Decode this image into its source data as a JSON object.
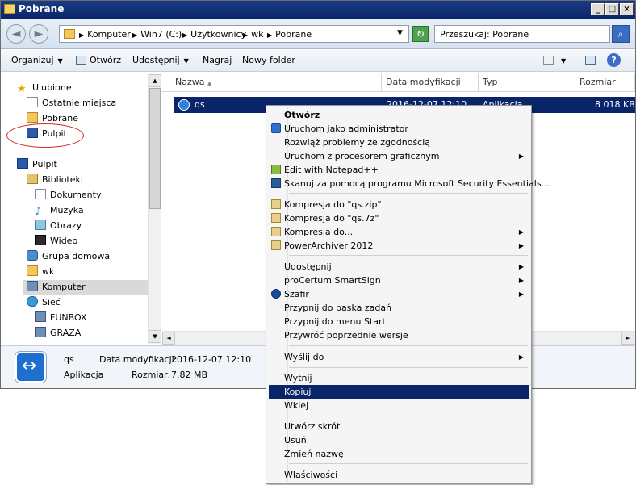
{
  "window": {
    "title": "Pobrane"
  },
  "address": {
    "crumbs": [
      "Komputer",
      "Win7 (C:)",
      "Użytkownicy",
      "wk",
      "Pobrane"
    ],
    "search_placeholder": "Przeszukaj: Pobrane"
  },
  "toolbar": {
    "organize": "Organizuj",
    "open": "Otwórz",
    "share": "Udostępnij",
    "burn": "Nagraj",
    "new_folder": "Nowy folder"
  },
  "nav": {
    "favorites": "Ulubione",
    "recent": "Ostatnie miejsca",
    "downloads": "Pobrane",
    "desktop_fav": "Pulpit",
    "desktop": "Pulpit",
    "libraries": "Biblioteki",
    "documents": "Dokumenty",
    "music": "Muzyka",
    "pictures": "Obrazy",
    "videos": "Wideo",
    "homegroup": "Grupa domowa",
    "user": "wk",
    "computer": "Komputer",
    "network": "Sieć",
    "net1": "FUNBOX",
    "net2": "GRAZA"
  },
  "columns": {
    "name": "Nazwa",
    "modified": "Data modyfikacji",
    "type": "Typ",
    "size": "Rozmiar"
  },
  "file": {
    "name": "qs",
    "modified": "2016-12-07 12:10",
    "type": "Aplikacja",
    "size": "8 018 KB"
  },
  "details": {
    "name": "qs",
    "modified_label": "Data modyfikacji:",
    "modified": "2016-12-07 12:10",
    "type": "Aplikacja",
    "size_label": "Rozmiar:",
    "size": "7.82 MB"
  },
  "context_menu": {
    "open": "Otwórz",
    "run_admin": "Uruchom jako administrator",
    "troubleshoot": "Rozwiąż problemy ze zgodnością",
    "run_gpu": "Uruchom z procesorem graficznym",
    "notepad": "Edit with Notepad++",
    "mse": "Skanuj za pomocą programu Microsoft Security Essentials...",
    "zip": "Kompresja do \"qs.zip\"",
    "sevenz": "Kompresja do \"qs.7z\"",
    "compress": "Kompresja do...",
    "powerarchiver": "PowerArchiver 2012",
    "share": "Udostępnij",
    "procertum": "proCertum SmartSign",
    "szafir": "Szafir",
    "pin_taskbar": "Przypnij do paska zadań",
    "pin_start": "Przypnij do menu Start",
    "restore": "Przywróć poprzednie wersje",
    "send_to": "Wyślij do",
    "cut": "Wytnij",
    "copy": "Kopiuj",
    "paste": "Wklej",
    "shortcut": "Utwórz skrót",
    "delete": "Usuń",
    "rename": "Zmień nazwę",
    "properties": "Właściwości"
  },
  "colors": {
    "selection": "#0a246a",
    "annotation": "#d42b2b"
  }
}
